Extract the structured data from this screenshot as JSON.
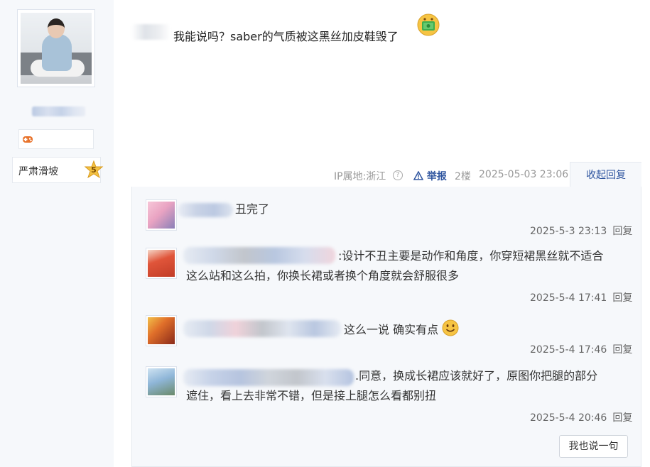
{
  "user": {
    "level_title": "严肃滑坡",
    "level": "5"
  },
  "post": {
    "text": "我能说吗？saber的气质被这黑丝加皮鞋毁了",
    "ip_label": "IP属地:浙江",
    "report_label": "举报",
    "floor": "2楼",
    "time": "2025-05-03 23:06",
    "collapse_label": "收起回复"
  },
  "replies": [
    {
      "text": "丑完了",
      "time": "2025-5-3 23:13",
      "reply_label": "回复"
    },
    {
      "text_line1": ":设计不丑主要是动作和角度，你穿短裙黑丝就不适合",
      "text_line2": "这么站和这么拍，你换长裙或者换个角度就会舒服很多",
      "time": "2025-5-4 17:41",
      "reply_label": "回复"
    },
    {
      "text": "这么一说 确实有点",
      "time": "2025-5-4 17:46",
      "reply_label": "回复"
    },
    {
      "text_line1": ".同意，换成长裙应该就好了，原图你把腿的部分",
      "text_line2": "遮住，看上去非常不错，但是接上腿怎么看都别扭",
      "time": "2025-5-4 20:46",
      "reply_label": "回复"
    }
  ],
  "say_button_label": "我也说一句",
  "colors": {
    "link": "#3056a0",
    "panel_bg": "#f6f8fb",
    "border": "#e5e9ef"
  }
}
